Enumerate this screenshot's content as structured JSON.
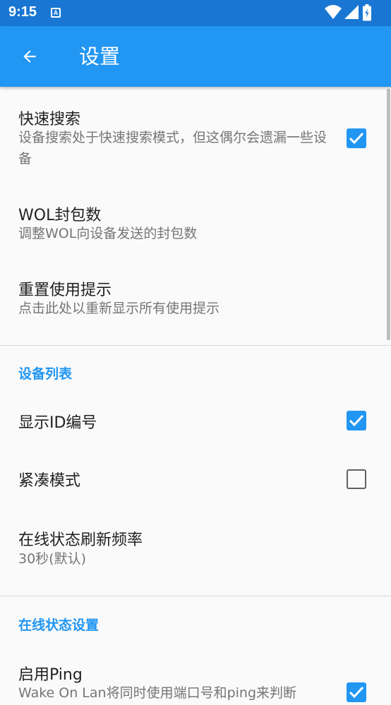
{
  "status_bar": {
    "time": "9:15",
    "notification_icon": "a-icon",
    "icons": [
      "wifi-icon",
      "signal-icon",
      "battery-icon"
    ]
  },
  "app_bar": {
    "back_icon": "arrow-left-icon",
    "title": "设置"
  },
  "preferences": {
    "fast_search": {
      "title": "快速搜索",
      "summary": "设备搜索处于快速搜索模式，但这偶尔会遗漏一些设备",
      "checked": true
    },
    "wol_packets": {
      "title": "WOL封包数",
      "summary": "调整WOL向设备发送的封包数"
    },
    "reset_hints": {
      "title": "重置使用提示",
      "summary": "点击此处以重新显示所有使用提示"
    }
  },
  "device_list": {
    "header": "设备列表",
    "show_id": {
      "title": "显示ID编号",
      "checked": true
    },
    "compact_mode": {
      "title": "紧凑模式",
      "checked": false
    },
    "refresh_rate": {
      "title": "在线状态刷新频率",
      "summary": "30秒(默认)"
    }
  },
  "online_status": {
    "header": "在线状态设置",
    "enable_ping": {
      "title": "启用Ping",
      "summary": "Wake On Lan将同时使用端口号和ping来判断",
      "checked": true
    }
  },
  "colors": {
    "status_bar": "#1976d2",
    "app_bar": "#2196f3",
    "accent": "#2196f3",
    "primary_text": "#212121",
    "secondary_text": "#757575"
  }
}
